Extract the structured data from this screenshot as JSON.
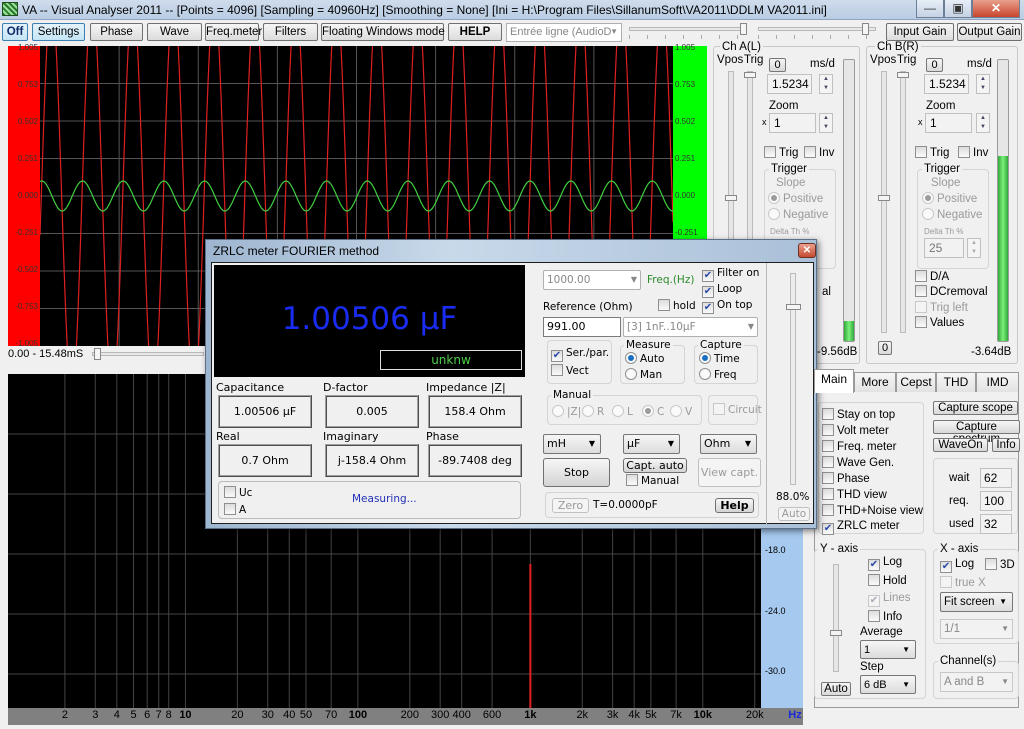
{
  "window": {
    "title": "VA -- Visual Analyser 2011 --  [Points = 4096]  [Sampling = 40960Hz]  [Smoothing = None]  [Ini = H:\\Program Files\\SillanumSoft\\VA2011\\DDLM VA2011.ini]",
    "controls": {
      "minimize": "—",
      "maximize": "▣",
      "close": "✕"
    }
  },
  "toolbar": {
    "off": "Off",
    "settings": "Settings",
    "phase": "Phase",
    "wave": "Wave",
    "freqmeter": "Freq.meter",
    "filters": "Filters",
    "floating": "Floating Windows mode",
    "help": "HELP",
    "input_device": "Entrée ligne (AudioD",
    "input_gain": "Input Gain",
    "output_gain": "Output Gain"
  },
  "scope": {
    "y_labels": [
      "1.005",
      "0.753",
      "0.502",
      "0.251",
      "0.000",
      "-0.251",
      "-0.502",
      "-0.753",
      "-1.005"
    ],
    "time_range": "0.00 - 15.48mS",
    "colors": {
      "ch_a": "#e02020",
      "ch_b": "#40d040",
      "left_axis": "#ff0000",
      "right_axis": "#00ff00"
    }
  },
  "channel_a": {
    "title": "Ch A(L)",
    "vpos": "Vpos",
    "trig": "Trig",
    "zero_btn": "0",
    "msd_label": "ms/d",
    "msd_value": "1.5234",
    "zoom_label": "Zoom",
    "zoom_x": "x",
    "zoom_value": "1",
    "trig_cb": "Trig",
    "inv_cb": "Inv",
    "trigger_group": "Trigger",
    "slope": "Slope",
    "positive": "Positive",
    "negative": "Negative",
    "delta": "Delta Th %",
    "partial_label": "al",
    "level": "-9.56dB",
    "level_fill": 0.07
  },
  "channel_b": {
    "title": "Ch B(R)",
    "vpos": "Vpos",
    "trig": "Trig",
    "zero_btn": "0",
    "msd_label": "ms/d",
    "msd_value": "1.5234",
    "zoom_label": "Zoom",
    "zoom_x": "x",
    "zoom_value": "1",
    "trig_cb": "Trig",
    "inv_cb": "Inv",
    "trigger_group": "Trigger",
    "slope": "Slope",
    "positive": "Positive",
    "negative": "Negative",
    "delta": "Delta Th %",
    "delta_value": "25",
    "da": "D/A",
    "dcremoval": "DCremoval",
    "trig_left": "Trig left",
    "values": "Values",
    "bottom_zero": "0",
    "level": "-3.64dB",
    "level_fill": 0.66
  },
  "spectrum": {
    "y_labels": [
      "-18.0",
      "-24.0",
      "-30.0"
    ],
    "x_ticks": [
      {
        "label": "2",
        "hz": 2
      },
      {
        "label": "3",
        "hz": 3
      },
      {
        "label": "4",
        "hz": 4
      },
      {
        "label": "5",
        "hz": 5
      },
      {
        "label": "6",
        "hz": 6
      },
      {
        "label": "7",
        "hz": 7
      },
      {
        "label": "8",
        "hz": 8
      },
      {
        "label": "10",
        "hz": 10,
        "bold": true
      },
      {
        "label": "20",
        "hz": 20
      },
      {
        "label": "30",
        "hz": 30
      },
      {
        "label": "40",
        "hz": 40
      },
      {
        "label": "50",
        "hz": 50
      },
      {
        "label": "70",
        "hz": 70
      },
      {
        "label": "100",
        "hz": 100,
        "bold": true
      },
      {
        "label": "200",
        "hz": 200
      },
      {
        "label": "300",
        "hz": 300
      },
      {
        "label": "400",
        "hz": 400
      },
      {
        "label": "600",
        "hz": 600
      },
      {
        "label": "1k",
        "hz": 1000,
        "bold": true
      },
      {
        "label": "2k",
        "hz": 2000
      },
      {
        "label": "3k",
        "hz": 3000
      },
      {
        "label": "4k",
        "hz": 4000
      },
      {
        "label": "5k",
        "hz": 5000
      },
      {
        "label": "7k",
        "hz": 7000
      },
      {
        "label": "10k",
        "hz": 10000,
        "bold": true
      },
      {
        "label": "20k",
        "hz": 20000
      }
    ],
    "unit": "Hz",
    "peak_hz": 1000
  },
  "zrlc": {
    "title": "ZRLC meter FOURIER method",
    "close": "✕",
    "main_value": "1.00506 µF",
    "status": "unknw",
    "measures": [
      {
        "label": "Capacitance",
        "value": "1.00506 µF"
      },
      {
        "label": "D-factor",
        "value": "0.005"
      },
      {
        "label": "Impedance |Z|",
        "value": "158.4 Ohm"
      },
      {
        "label": "Real",
        "value": "0.7 Ohm"
      },
      {
        "label": "Imaginary",
        "value": "j-158.4 Ohm"
      },
      {
        "label": "Phase",
        "value": "-89.7408 deg"
      }
    ],
    "uc": "Uc",
    "a": "A",
    "measuring": "Measuring...",
    "freq_value": "1000.00",
    "freq_label": "Freq.(Hz)",
    "filter_on": "Filter on",
    "loop": "Loop",
    "on_top": "On top",
    "hold": "hold",
    "reference_label": "Reference (Ohm)",
    "reference_value": "991.00",
    "range": "[3]  1nF..10µF",
    "ser_par": "Ser./par.",
    "vect": "Vect",
    "measure_group": "Measure",
    "auto": "Auto",
    "man": "Man",
    "capture_group": "Capture",
    "time": "Time",
    "freq": "Freq",
    "manual_group": "Manual",
    "manual_opts": [
      "|Z|",
      "R",
      "L",
      "C",
      "V"
    ],
    "circuit": "Circuit",
    "unit_l": "mH",
    "unit_c": "µF",
    "unit_r": "Ohm",
    "stop": "Stop",
    "capt_auto": "Capt. auto",
    "manual_cb": "Manual",
    "view_capt": "View capt.",
    "zero": "Zero",
    "t_value": "T=0.0000pF",
    "help": "Help",
    "level_pct": "88.0%",
    "auto_btn": "Auto"
  },
  "tabs": [
    "Main",
    "More",
    "Cepst",
    "THD",
    "IMD"
  ],
  "main_tab": {
    "options": [
      {
        "label": "Stay on top",
        "checked": false
      },
      {
        "label": "Volt meter",
        "checked": false
      },
      {
        "label": "Freq. meter",
        "checked": false
      },
      {
        "label": "Wave Gen.",
        "checked": false
      },
      {
        "label": "Phase",
        "checked": false
      },
      {
        "label": "THD view",
        "checked": false
      },
      {
        "label": "THD+Noise view",
        "checked": false
      },
      {
        "label": "ZRLC meter",
        "checked": true
      }
    ],
    "capture_scope": "Capture scope",
    "capture_spectrum": "Capture spectrum",
    "waveon": "WaveOn",
    "info": "Info",
    "wait_label": "wait",
    "wait_value": "62",
    "req_label": "req.",
    "req_value": "100",
    "used_label": "used",
    "used_value": "32"
  },
  "y_axis": {
    "title": "Y - axis",
    "log": "Log",
    "hold": "Hold",
    "lines": "Lines",
    "info": "Info",
    "average_label": "Average",
    "average_value": "1",
    "step_label": "Step",
    "step_value": "6 dB",
    "auto": "Auto"
  },
  "x_axis": {
    "title": "X - axis",
    "log": "Log",
    "three_d": "3D",
    "true_x": "true X",
    "fit": "Fit screen",
    "ratio": "1/1"
  },
  "channels": {
    "title": "Channel(s)",
    "value": "A and B"
  }
}
